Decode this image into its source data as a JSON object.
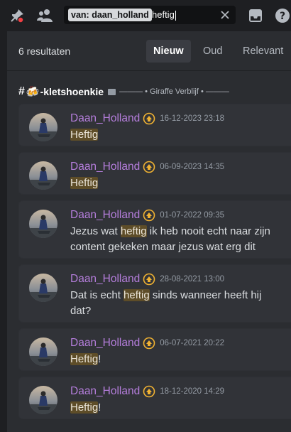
{
  "search": {
    "filter_key": "van:",
    "filter_value": "daan_holland",
    "query": "heftig"
  },
  "results": {
    "count_label": "6 resultaten",
    "sort_tabs": [
      "Nieuw",
      "Oud",
      "Relevant"
    ],
    "active_tab": "Nieuw"
  },
  "channel": {
    "prefix": "#",
    "emoji": "🍻",
    "name": "-kletshoenkie",
    "category": "——— • Giraffe Verblijf • ———"
  },
  "messages": [
    {
      "author": "Daan_Holland",
      "timestamp": "16-12-2023 23:18",
      "parts": [
        {
          "text": "Heftig",
          "highlight": true
        }
      ]
    },
    {
      "author": "Daan_Holland",
      "timestamp": "06-09-2023 14:35",
      "parts": [
        {
          "text": "Heftig",
          "highlight": true
        }
      ]
    },
    {
      "author": "Daan_Holland",
      "timestamp": "01-07-2022 09:35",
      "parts": [
        {
          "text": "Jezus wat ",
          "highlight": false
        },
        {
          "text": "heftig",
          "highlight": true
        },
        {
          "text": " ik heb nooit echt naar zijn content gekeken maar jezus wat erg dit",
          "highlight": false
        }
      ]
    },
    {
      "author": "Daan_Holland",
      "timestamp": "28-08-2021 13:00",
      "parts": [
        {
          "text": "Dat is echt ",
          "highlight": false
        },
        {
          "text": "heftig",
          "highlight": true
        },
        {
          "text": " sinds wanneer heeft hij dat?",
          "highlight": false
        }
      ]
    },
    {
      "author": "Daan_Holland",
      "timestamp": "06-07-2021 20:22",
      "parts": [
        {
          "text": "Heftig",
          "highlight": true
        },
        {
          "text": "!",
          "highlight": false
        }
      ]
    },
    {
      "author": "Daan_Holland",
      "timestamp": "18-12-2020 14:29",
      "parts": [
        {
          "text": "Heftig",
          "highlight": true
        },
        {
          "text": "!",
          "highlight": false
        }
      ]
    }
  ],
  "icons": [
    "pin-icon",
    "members-icon",
    "clear-search-icon",
    "inbox-icon",
    "help-icon",
    "hypesquad-badge-icon"
  ],
  "colors": {
    "background": "#1e1f22",
    "panel": "#2b2d31",
    "card": "#313338",
    "author": "#b57edc",
    "highlight": "#5e4d28",
    "pin_dot": "#f23f43",
    "badge": "#f0b232"
  }
}
